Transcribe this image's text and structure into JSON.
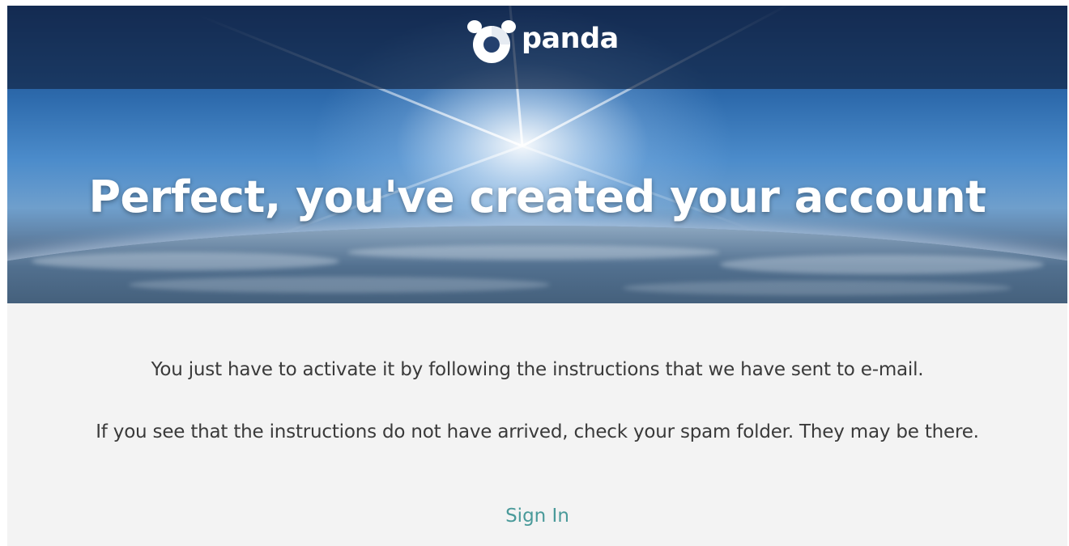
{
  "brand": {
    "logo_text": "panda",
    "logo_icon": "panda-logo-icon"
  },
  "hero": {
    "title": "Perfect, you've created your account"
  },
  "content": {
    "line1": "You just have to activate it by following the instructions that we have sent to e-mail.",
    "line2": "If you see that the instructions do not have arrived, check your spam folder. They may be there.",
    "signin_link": "Sign In"
  },
  "colors": {
    "link": "#4a9a9a",
    "text": "#3a3a3a",
    "panel_bg": "#f3f3f3"
  }
}
